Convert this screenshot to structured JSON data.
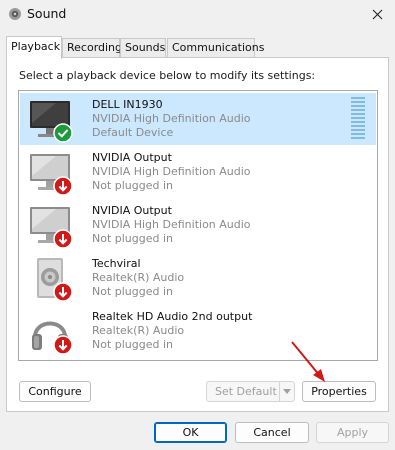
{
  "window": {
    "title": "Sound"
  },
  "tabs": [
    {
      "label": "Playback"
    },
    {
      "label": "Recording"
    },
    {
      "label": "Sounds"
    },
    {
      "label": "Communications"
    }
  ],
  "panel": {
    "instruction": "Select a playback device below to modify its settings:"
  },
  "devices": [
    {
      "name": "DELL IN1930",
      "driver": "NVIDIA High Definition Audio",
      "status": "Default Device",
      "icon": "monitor-icon",
      "badge": "check-badge-icon"
    },
    {
      "name": "NVIDIA Output",
      "driver": "NVIDIA High Definition Audio",
      "status": "Not plugged in",
      "icon": "monitor-icon",
      "badge": "down-arrow-badge-icon"
    },
    {
      "name": "NVIDIA Output",
      "driver": "NVIDIA High Definition Audio",
      "status": "Not plugged in",
      "icon": "monitor-icon",
      "badge": "down-arrow-badge-icon"
    },
    {
      "name": "Techviral",
      "driver": "Realtek(R) Audio",
      "status": "Not plugged in",
      "icon": "speaker-icon",
      "badge": "down-arrow-badge-icon"
    },
    {
      "name": "Realtek HD Audio 2nd output",
      "driver": "Realtek(R) Audio",
      "status": "Not plugged in",
      "icon": "headphones-icon",
      "badge": "down-arrow-badge-icon"
    }
  ],
  "buttons": {
    "configure": "Configure",
    "set_default": "Set Default",
    "properties": "Properties",
    "ok": "OK",
    "cancel": "Cancel",
    "apply": "Apply"
  },
  "colors": {
    "selected_row": "#cce8ff",
    "annotation_arrow": "#d0191b",
    "default_badge": "#1e9a3e",
    "unplugged_badge": "#d01919"
  }
}
